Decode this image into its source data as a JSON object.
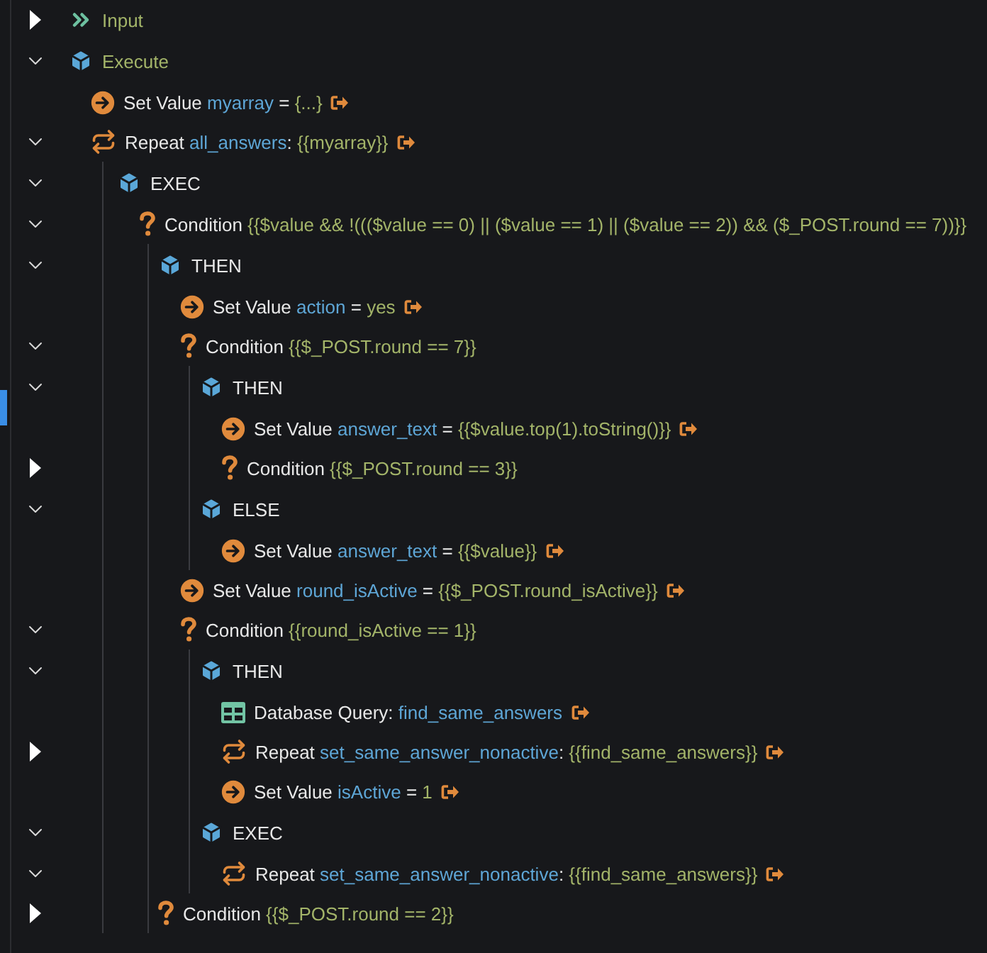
{
  "tree": [
    {
      "kind": "input",
      "expanded": false,
      "parts": [
        {
          "kind": "title",
          "text": "Input"
        }
      ]
    },
    {
      "kind": "block",
      "expanded": true,
      "parts": [
        {
          "kind": "title",
          "text": "Execute"
        }
      ],
      "children": [
        {
          "kind": "set",
          "link": true,
          "parts": [
            {
              "kind": "label",
              "text": "Set Value "
            },
            {
              "kind": "variable",
              "text": "myarray"
            },
            {
              "kind": "label",
              "text": " = "
            },
            {
              "kind": "value",
              "text": "{...}"
            }
          ]
        },
        {
          "kind": "repeat",
          "expanded": true,
          "link": true,
          "parts": [
            {
              "kind": "label",
              "text": "Repeat "
            },
            {
              "kind": "variable",
              "text": "all_answers"
            },
            {
              "kind": "label",
              "text": ": "
            },
            {
              "kind": "value",
              "text": "{{myarray}}"
            }
          ],
          "children": [
            {
              "kind": "block",
              "expanded": true,
              "parts": [
                {
                  "kind": "label",
                  "text": "EXEC"
                }
              ],
              "children": [
                {
                  "kind": "condition",
                  "expanded": true,
                  "parts": [
                    {
                      "kind": "label",
                      "text": "Condition "
                    },
                    {
                      "kind": "value",
                      "text": "{{$value && !((($value == 0) || ($value == 1) || ($value == 2)) && ($_POST.round == 7))}}"
                    }
                  ],
                  "children": [
                    {
                      "kind": "block",
                      "expanded": true,
                      "parts": [
                        {
                          "kind": "label",
                          "text": "THEN"
                        }
                      ],
                      "children": [
                        {
                          "kind": "set",
                          "link": true,
                          "parts": [
                            {
                              "kind": "label",
                              "text": "Set Value "
                            },
                            {
                              "kind": "variable",
                              "text": "action"
                            },
                            {
                              "kind": "label",
                              "text": " = "
                            },
                            {
                              "kind": "value",
                              "text": "yes"
                            }
                          ]
                        },
                        {
                          "kind": "condition",
                          "expanded": true,
                          "parts": [
                            {
                              "kind": "label",
                              "text": "Condition "
                            },
                            {
                              "kind": "value",
                              "text": "{{$_POST.round == 7}}"
                            }
                          ],
                          "children": [
                            {
                              "kind": "block",
                              "expanded": true,
                              "parts": [
                                {
                                  "kind": "label",
                                  "text": "THEN"
                                }
                              ],
                              "children": [
                                {
                                  "kind": "set",
                                  "link": true,
                                  "parts": [
                                    {
                                      "kind": "label",
                                      "text": "Set Value "
                                    },
                                    {
                                      "kind": "variable",
                                      "text": "answer_text"
                                    },
                                    {
                                      "kind": "label",
                                      "text": " = "
                                    },
                                    {
                                      "kind": "value",
                                      "text": "{{$value.top(1).toString()}}"
                                    }
                                  ]
                                },
                                {
                                  "kind": "condition",
                                  "expanded": false,
                                  "parts": [
                                    {
                                      "kind": "label",
                                      "text": "Condition "
                                    },
                                    {
                                      "kind": "value",
                                      "text": "{{$_POST.round == 3}}"
                                    }
                                  ]
                                }
                              ]
                            },
                            {
                              "kind": "block",
                              "expanded": true,
                              "parts": [
                                {
                                  "kind": "label",
                                  "text": "ELSE"
                                }
                              ],
                              "children": [
                                {
                                  "kind": "set",
                                  "link": true,
                                  "parts": [
                                    {
                                      "kind": "label",
                                      "text": "Set Value "
                                    },
                                    {
                                      "kind": "variable",
                                      "text": "answer_text"
                                    },
                                    {
                                      "kind": "label",
                                      "text": " = "
                                    },
                                    {
                                      "kind": "value",
                                      "text": "{{$value}}"
                                    }
                                  ]
                                }
                              ]
                            }
                          ]
                        },
                        {
                          "kind": "set",
                          "link": true,
                          "parts": [
                            {
                              "kind": "label",
                              "text": "Set Value "
                            },
                            {
                              "kind": "variable",
                              "text": "round_isActive"
                            },
                            {
                              "kind": "label",
                              "text": " = "
                            },
                            {
                              "kind": "value",
                              "text": "{{$_POST.round_isActive}}"
                            }
                          ]
                        },
                        {
                          "kind": "condition",
                          "expanded": true,
                          "parts": [
                            {
                              "kind": "label",
                              "text": "Condition "
                            },
                            {
                              "kind": "value",
                              "text": "{{round_isActive == 1}}"
                            }
                          ],
                          "children": [
                            {
                              "kind": "block",
                              "expanded": true,
                              "parts": [
                                {
                                  "kind": "label",
                                  "text": "THEN"
                                }
                              ],
                              "children": [
                                {
                                  "kind": "query",
                                  "link": true,
                                  "parts": [
                                    {
                                      "kind": "label",
                                      "text": "Database Query: "
                                    },
                                    {
                                      "kind": "variable",
                                      "text": "find_same_answers"
                                    }
                                  ]
                                },
                                {
                                  "kind": "repeat",
                                  "expanded": false,
                                  "link": true,
                                  "parts": [
                                    {
                                      "kind": "label",
                                      "text": "Repeat "
                                    },
                                    {
                                      "kind": "variable",
                                      "text": "set_same_answer_nonactive"
                                    },
                                    {
                                      "kind": "label",
                                      "text": ": "
                                    },
                                    {
                                      "kind": "value",
                                      "text": "{{find_same_answers}}"
                                    }
                                  ]
                                },
                                {
                                  "kind": "set",
                                  "link": true,
                                  "parts": [
                                    {
                                      "kind": "label",
                                      "text": "Set Value "
                                    },
                                    {
                                      "kind": "variable",
                                      "text": "isActive"
                                    },
                                    {
                                      "kind": "label",
                                      "text": " = "
                                    },
                                    {
                                      "kind": "value",
                                      "text": "1"
                                    }
                                  ]
                                }
                              ]
                            },
                            {
                              "kind": "block",
                              "expanded": true,
                              "parts": [
                                {
                                  "kind": "label",
                                  "text": "EXEC"
                                }
                              ],
                              "children": [
                                {
                                  "kind": "repeat",
                                  "expanded": true,
                                  "link": true,
                                  "parts": [
                                    {
                                      "kind": "label",
                                      "text": "Repeat "
                                    },
                                    {
                                      "kind": "variable",
                                      "text": "set_same_answer_nonactive"
                                    },
                                    {
                                      "kind": "label",
                                      "text": ": "
                                    },
                                    {
                                      "kind": "value",
                                      "text": "{{find_same_answers}}"
                                    }
                                  ]
                                }
                              ]
                            }
                          ]
                        }
                      ]
                    },
                    {
                      "kind": "condition",
                      "expanded": false,
                      "parts": [
                        {
                          "kind": "label",
                          "text": "Condition "
                        },
                        {
                          "kind": "value",
                          "text": "{{$_POST.round == 2}}"
                        }
                      ]
                    }
                  ]
                }
              ]
            }
          ]
        }
      ]
    }
  ]
}
